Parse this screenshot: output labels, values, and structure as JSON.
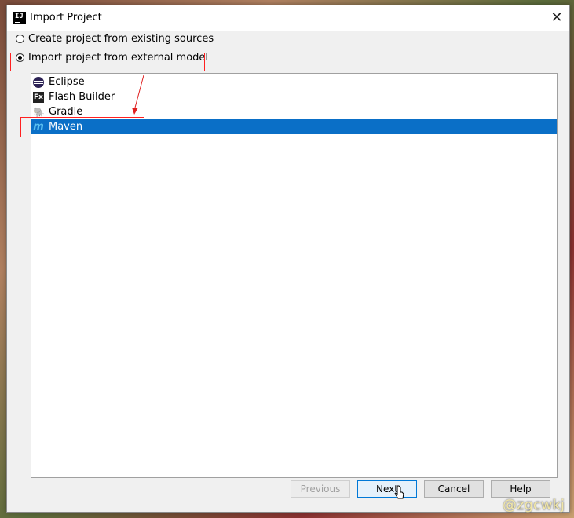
{
  "window": {
    "title": "Import Project",
    "icon_label": "IJ",
    "close_glyph": "✕"
  },
  "options": {
    "existing": "Create project from existing sources",
    "external": "Import project from external model",
    "selected": "external"
  },
  "models": [
    {
      "label": "Eclipse",
      "icon": "eclipse-icon"
    },
    {
      "label": "Flash Builder",
      "icon": "flash-builder-icon"
    },
    {
      "label": "Gradle",
      "icon": "gradle-icon"
    },
    {
      "label": "Maven",
      "icon": "maven-icon",
      "selected": true
    }
  ],
  "icons": {
    "flash": "Fx",
    "gradle": "🐘",
    "maven": "m"
  },
  "buttons": {
    "previous": "Previous",
    "next": "Next",
    "cancel": "Cancel",
    "help": "Help"
  },
  "watermark": "@zgcwkj",
  "colors": {
    "selection": "#0a6fc7",
    "annotation": "#ff2020",
    "default_button_border": "#0078d7"
  }
}
